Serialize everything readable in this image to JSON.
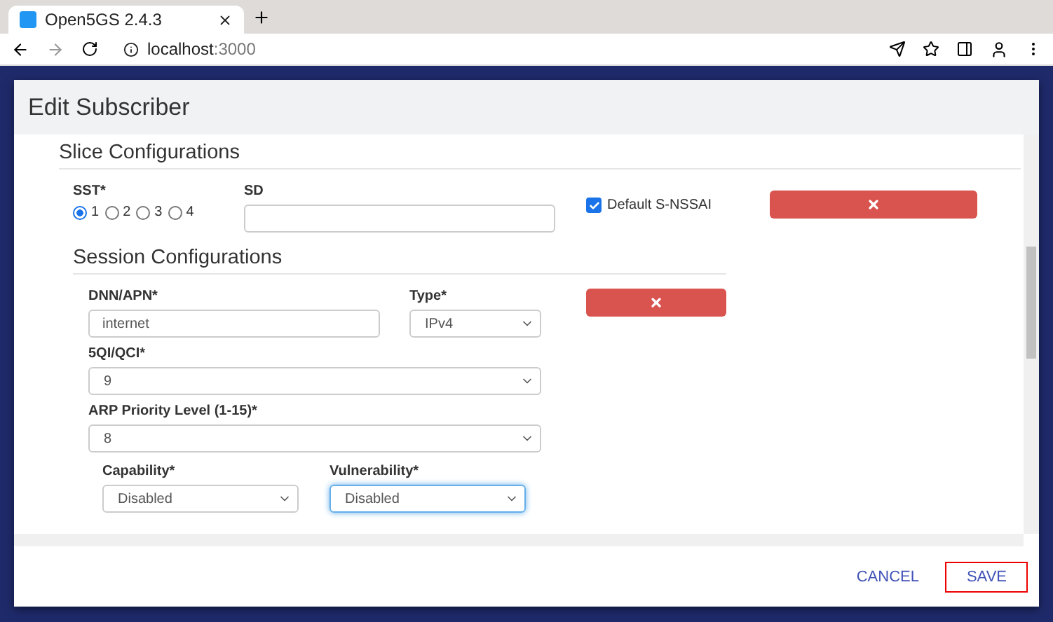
{
  "browser": {
    "tab_title": "Open5GS 2.4.3",
    "url_host": "localhost",
    "url_port": ":3000"
  },
  "dialog": {
    "title": "Edit Subscriber",
    "slice": {
      "title": "Slice Configurations",
      "sst_label": "SST*",
      "sst_options": [
        {
          "label": "1",
          "selected": true
        },
        {
          "label": "2",
          "selected": false
        },
        {
          "label": "3",
          "selected": false
        },
        {
          "label": "4",
          "selected": false
        }
      ],
      "sd_label": "SD",
      "default_snssai": {
        "label": "Default S-NSSAI",
        "checked": true
      }
    },
    "session": {
      "title": "Session Configurations",
      "dnn": {
        "label": "DNN/APN*",
        "value": "internet"
      },
      "type": {
        "label": "Type*",
        "value": "IPv4"
      },
      "qci": {
        "label": "5QI/QCI*",
        "value": "9"
      },
      "arp": {
        "label": "ARP Priority Level (1-15)*",
        "value": "8"
      },
      "capability": {
        "label": "Capability*",
        "value": "Disabled",
        "focused": false
      },
      "vulnerability": {
        "label": "Vulnerability*",
        "value": "Disabled",
        "focused": true
      }
    },
    "footer_buttons": [
      {
        "label": "CANCEL",
        "focused": false
      },
      {
        "label": "SAVE",
        "focused": true
      }
    ]
  }
}
